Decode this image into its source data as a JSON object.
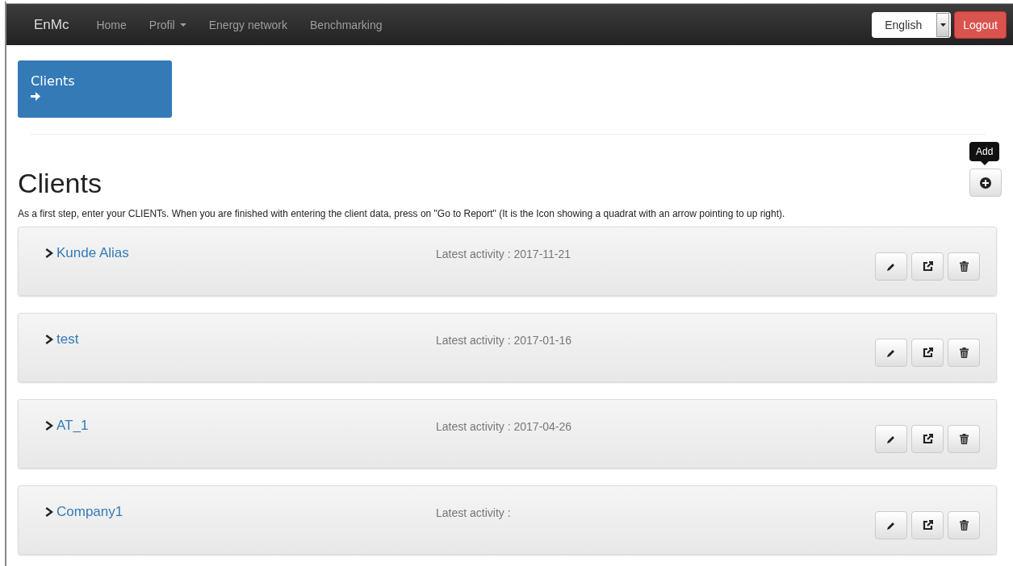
{
  "navbar": {
    "brand": "EnMc",
    "items": [
      {
        "label": "Home",
        "dropdown": false
      },
      {
        "label": "Profil",
        "dropdown": true
      },
      {
        "label": "Energy network",
        "dropdown": false
      },
      {
        "label": "Benchmarking",
        "dropdown": false
      }
    ],
    "language": "English",
    "logout": "Logout"
  },
  "tile": {
    "label": "Clients"
  },
  "add_tooltip": "Add",
  "heading": "Clients",
  "intro": "As a first step, enter your CLIENTs. When you are finished with entering the client data, press on \"Go to Report\" (It is the Icon showing a quadrat with an arrow pointing to up right).",
  "clients": [
    {
      "name": "Kunde Alias",
      "activity": "Latest activity : 2017-11-21"
    },
    {
      "name": "test",
      "activity": "Latest activity : 2017-01-16"
    },
    {
      "name": "AT_1",
      "activity": "Latest activity : 2017-04-26"
    },
    {
      "name": "Company1",
      "activity": "Latest activity :"
    }
  ]
}
